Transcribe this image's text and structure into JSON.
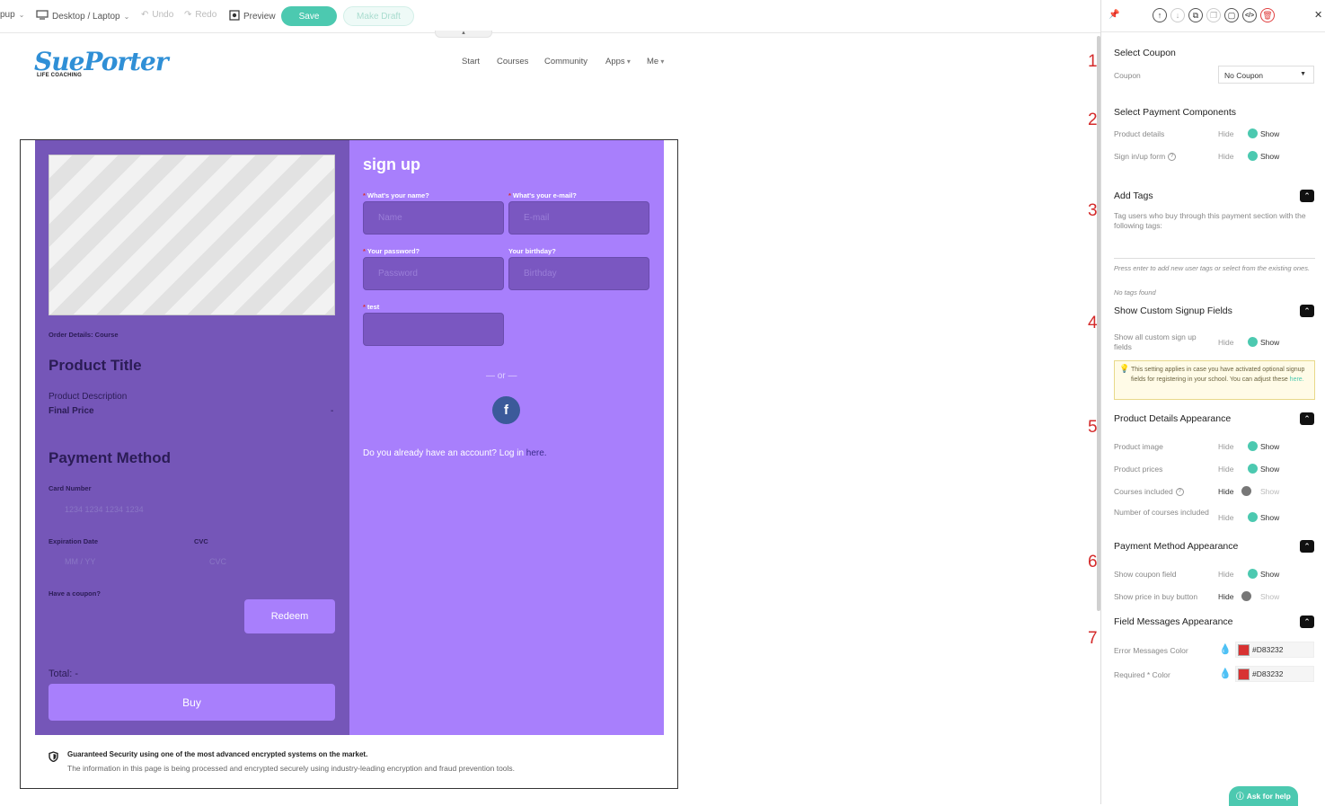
{
  "toolbar": {
    "popup_label": "pup",
    "device_label": "Desktop / Laptop",
    "undo_label": "Undo",
    "redo_label": "Redo",
    "preview_label": "Preview",
    "save_label": "Save",
    "draft_label": "Make Draft",
    "handle_glyph": "▴"
  },
  "site": {
    "logo_text": "SuePorter",
    "logo_subtext": "LIFE COACHING",
    "nav": [
      "Start",
      "Courses",
      "Community",
      "Apps",
      "Me"
    ]
  },
  "product": {
    "order_details": "Order Details: Course",
    "title": "Product Title",
    "description": "Product Description",
    "final_price_label": "Final Price",
    "final_price_value": "-",
    "payment_heading": "Payment Method",
    "card_number_label": "Card Number",
    "card_number_placeholder": "1234 1234 1234 1234",
    "expiration_label": "Expiration Date",
    "expiration_placeholder": "MM / YY",
    "cvc_label": "CVC",
    "cvc_placeholder": "CVC",
    "coupon_label": "Have a coupon?",
    "redeem_label": "Redeem",
    "total_label": "Total: -",
    "buy_label": "Buy",
    "security_title": "Guaranteed Security using one of the most advanced encrypted systems on the market.",
    "security_text": "The information in this page is being processed and encrypted securely using industry-leading encryption and fraud prevention tools."
  },
  "signup": {
    "heading": "sign up",
    "name_label": "What's your name?",
    "name_placeholder": "Name",
    "email_label": "What's your e-mail?",
    "email_placeholder": "E-mail",
    "password_label": "Your password?",
    "password_placeholder": "Password",
    "birthday_label": "Your birthday?",
    "birthday_placeholder": "Birthday",
    "test_label": "test",
    "or_text": "— or —",
    "facebook_glyph": "f",
    "login_text": "Do you already have an account? Log in",
    "login_link": "here."
  },
  "panel": {
    "icons": [
      "pin-icon",
      "move-up-icon",
      "move-down-icon",
      "duplicate-icon",
      "copy-icon",
      "paste-icon",
      "code-icon",
      "delete-icon",
      "close-icon"
    ],
    "sections": [
      {
        "num": "1",
        "title": "Select Coupon"
      },
      {
        "num": "2",
        "title": "Select Payment Components"
      },
      {
        "num": "3",
        "title": "Add Tags"
      },
      {
        "num": "4",
        "title": "Show Custom Signup Fields"
      },
      {
        "num": "5",
        "title": "Product Details Appearance"
      },
      {
        "num": "6",
        "title": "Payment Method Appearance"
      },
      {
        "num": "7",
        "title": "Field Messages Appearance"
      }
    ],
    "coupon_label": "Coupon",
    "coupon_value": "No Coupon",
    "hide": "Hide",
    "show": "Show",
    "rows": {
      "product_details": "Product details",
      "sign_form": "Sign in/up form",
      "custom_fields": "Show all custom sign up fields",
      "product_image": "Product image",
      "product_prices": "Product prices",
      "courses_included": "Courses included",
      "number_courses": "Number of courses included",
      "show_coupon": "Show coupon field",
      "show_price": "Show price in buy button",
      "error_color": "Error Messages Color",
      "required_color": "Required * Color"
    },
    "toggles": {
      "product_details": true,
      "sign_form": true,
      "custom_fields": true,
      "product_image": true,
      "product_prices": true,
      "courses_included": false,
      "number_courses": true,
      "show_coupon": true,
      "show_price": false
    },
    "tags_desc": "Tag users who buy through this payment section with the following tags:",
    "tags_hint": "Press enter to add new user tags or select from the existing ones.",
    "tags_empty": "No tags found",
    "info_text": "This setting applies in case you have activated optional signup fields for registering in your school. You can adjust these",
    "info_link": "here.",
    "error_color_value": "#D83232",
    "required_color_value": "#D83232",
    "help_label": "Ask for help"
  },
  "colors": {
    "accent": "#4cc9b0",
    "left_column": "#7556b8",
    "right_column": "#a87ffc",
    "error": "#D83232"
  }
}
